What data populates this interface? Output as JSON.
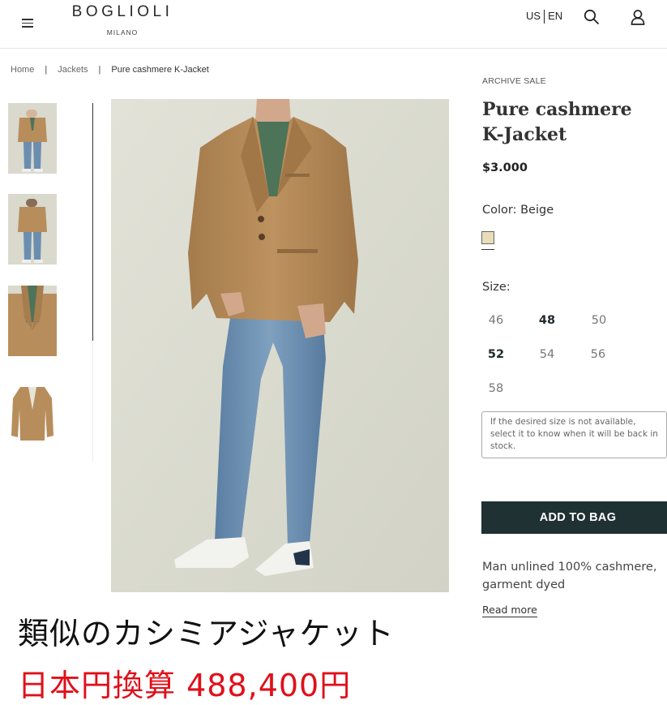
{
  "header": {
    "menu_icon": "hamburger-icon",
    "logo_main": "BOGLIOLI",
    "logo_sub": "MILANO",
    "lang_country": "US",
    "lang_language": "EN",
    "search_icon": "search-icon",
    "account_icon": "user-icon"
  },
  "breadcrumb": {
    "items": [
      "Home",
      "Jackets",
      "Pure cashmere K-Jacket"
    ],
    "separator": "|"
  },
  "gallery": {
    "thumbnail_count": 4,
    "active_thumbnail": 1
  },
  "product": {
    "tag": "ARCHIVE SALE",
    "title": "Pure cashmere K-Jacket",
    "price": "$3.000",
    "color_label": "Color: Beige",
    "swatch_color": "#e8dcb9",
    "size_label": "Size:",
    "sizes": [
      {
        "label": "46",
        "available": false
      },
      {
        "label": "48",
        "available": true
      },
      {
        "label": "50",
        "available": false
      },
      {
        "label": "52",
        "available": true
      },
      {
        "label": "54",
        "available": false
      },
      {
        "label": "56",
        "available": false
      },
      {
        "label": "58",
        "available": false
      }
    ],
    "size_note": "If the desired size is not available, select it to know when it will be back in stock.",
    "add_to_bag": "ADD TO BAG",
    "description": "Man unlined 100% cashmere, garment dyed",
    "read_more": "Read more"
  },
  "overlay": {
    "caption_line1": "類似のカシミアジャケット",
    "caption_line2": "日本円換算 488,400円",
    "caption2_color": "#e0101a"
  },
  "colors": {
    "accent_button": "#1f3133",
    "jacket": "#b88d5c",
    "jeans": "#6b8eb0",
    "background_photo": "#dcdcd0"
  }
}
